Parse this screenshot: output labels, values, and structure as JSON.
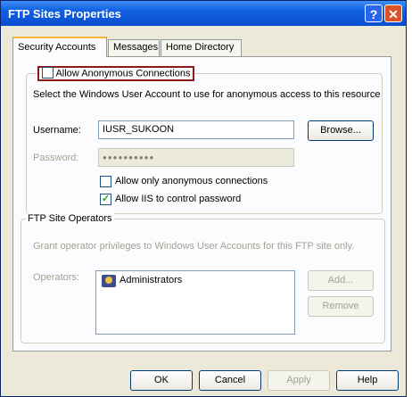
{
  "window": {
    "title": "FTP Sites Properties",
    "help_glyph": "?",
    "close_glyph": "✕"
  },
  "tabs": [
    {
      "label": "Security Accounts",
      "active": true
    },
    {
      "label": "Messages",
      "active": false
    },
    {
      "label": "Home Directory",
      "active": false
    }
  ],
  "anonymous": {
    "checkbox_label": "Allow Anonymous Connections",
    "checked": false,
    "instruction": "Select the Windows User Account to use for anonymous access to this resource",
    "username_label": "Username:",
    "username_value": "IUSR_SUKOON",
    "browse_label": "Browse...",
    "password_label": "Password:",
    "password_value": "●●●●●●●●●●",
    "only_anon_label": "Allow only anonymous connections",
    "only_anon_checked": false,
    "iis_control_label": "Allow IIS to control password",
    "iis_control_checked": true,
    "check_glyph": "✓"
  },
  "operators": {
    "group_title": "FTP Site Operators",
    "description": "Grant operator privileges to Windows User Accounts for this FTP site only.",
    "operators_label": "Operators:",
    "items": [
      "Administrators"
    ],
    "add_label": "Add...",
    "remove_label": "Remove"
  },
  "footer": {
    "ok": "OK",
    "cancel": "Cancel",
    "apply": "Apply",
    "help": "Help"
  },
  "colors": {
    "titlebar": "#0a4fd0",
    "highlight_border": "#8b1a1a",
    "check": "#21a121"
  }
}
